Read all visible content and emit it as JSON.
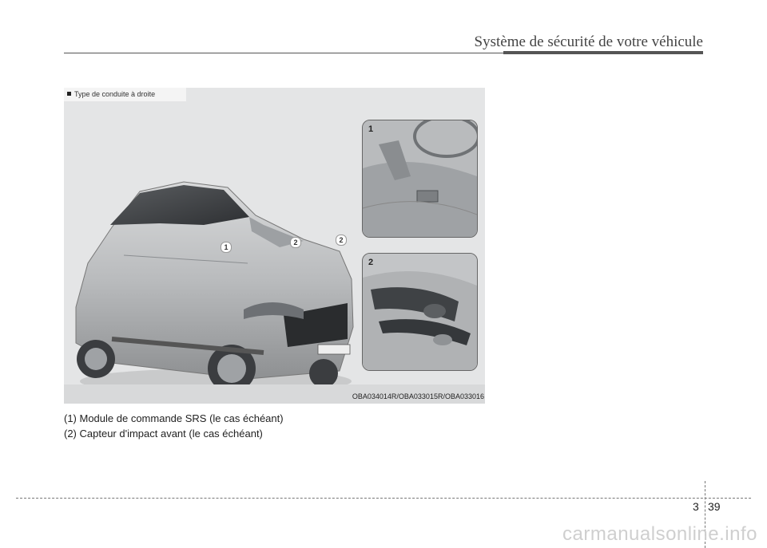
{
  "header": {
    "title": "Système de sécurité de votre véhicule"
  },
  "figure": {
    "tag": "Type de conduite à droite",
    "code": "OBA034014R/OBA033015R/OBA033016",
    "callouts": [
      "1",
      "2",
      "2"
    ],
    "insets": [
      {
        "number": "1"
      },
      {
        "number": "2"
      }
    ]
  },
  "captions": [
    "(1) Module de commande SRS (le cas échéant)",
    "(2) Capteur d'impact avant (le cas échéant)"
  ],
  "footer": {
    "section": "3",
    "page": "39"
  },
  "watermark": "carmanualsonline.info"
}
